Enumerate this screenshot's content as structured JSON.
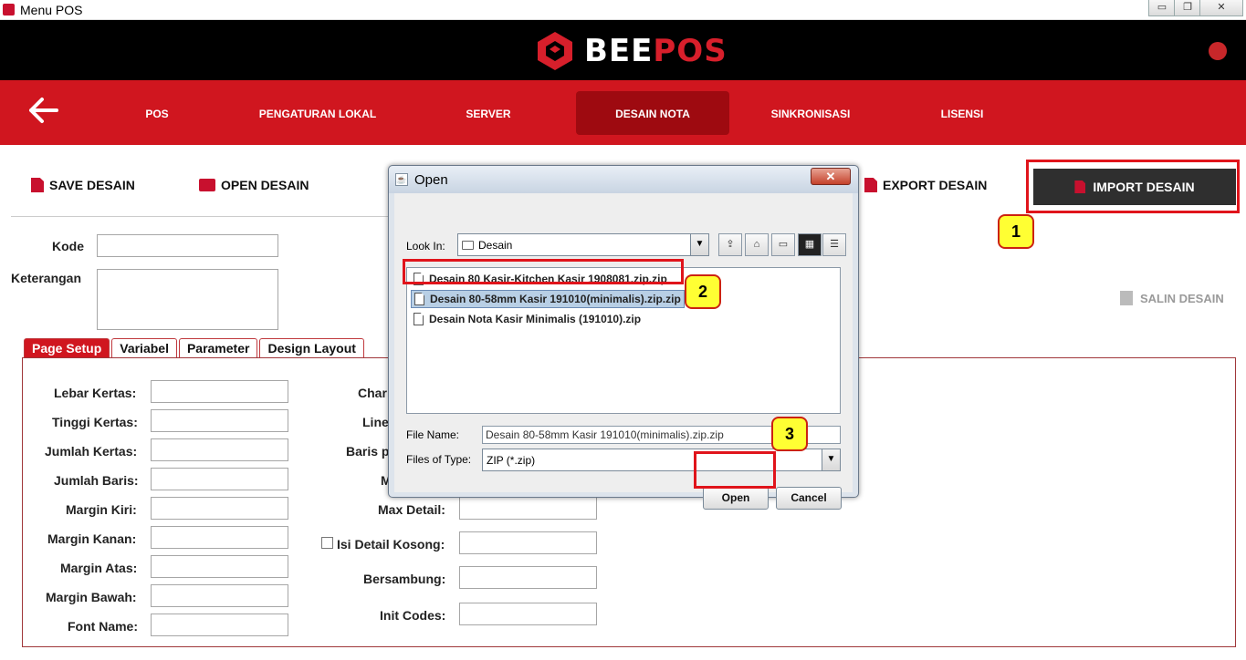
{
  "window": {
    "title": "Menu POS",
    "controls": [
      "▭",
      "❐",
      "✕"
    ]
  },
  "brand": {
    "logo_part1": "BEE",
    "logo_part2": "POS"
  },
  "nav": {
    "back_glyph": "🡐",
    "items": [
      {
        "label": "POS"
      },
      {
        "label": "PENGATURAN LOKAL"
      },
      {
        "label": "SERVER"
      },
      {
        "label": "DESAIN NOTA"
      },
      {
        "label": "SINKRONISASI"
      },
      {
        "label": "LISENSI"
      }
    ]
  },
  "toolbar": {
    "save_label": "SAVE DESAIN",
    "open_label": "OPEN DESAIN",
    "export_label": "EXPORT DESAIN",
    "import_label": "IMPORT DESAIN",
    "salin_label": "SALIN DESAIN"
  },
  "form": {
    "kode_label": "Kode",
    "keterangan_label": "Keterangan"
  },
  "tabs": [
    {
      "label": "Page Setup"
    },
    {
      "label": "Variabel"
    },
    {
      "label": "Parameter"
    },
    {
      "label": "Design Layout"
    }
  ],
  "page_setup": {
    "left_labels": [
      "Lebar Kertas:",
      "Tinggi Kertas:",
      "Jumlah Kertas:",
      "Jumlah Baris:",
      "Margin Kiri:",
      "Margin Kanan:",
      "Margin Atas:",
      "Margin Bawah:",
      "Font Name:"
    ],
    "right_partial": [
      "Char",
      "Line",
      "Baris p",
      "M"
    ],
    "right_labels": [
      "Max Detail:",
      "Isi Detail Kosong:",
      "Bersambung:",
      "Init Codes:"
    ]
  },
  "dialog": {
    "title": "Open",
    "close_glyph": "✕",
    "look_in_label": "Look In:",
    "look_in_value": "Desain",
    "files": [
      "Desain 80 Kasir-Kitchen Kasir 1908081.zip.zip",
      "Desain 80-58mm Kasir 191010(minimalis).zip.zip",
      "Desain Nota Kasir Minimalis (191010).zip"
    ],
    "file_name_label": "File Name:",
    "file_name_value": "Desain 80-58mm Kasir 191010(minimalis).zip.zip",
    "files_of_type_label": "Files of Type:",
    "files_of_type_value": "ZIP (*.zip)",
    "open_label": "Open",
    "cancel_label": "Cancel"
  },
  "badges": [
    "1",
    "2",
    "3"
  ],
  "colors": {
    "brand_red": "#d0161f",
    "dark_red": "#9e0a10",
    "highlight": "#e0141b",
    "badge": "#ffff33"
  }
}
